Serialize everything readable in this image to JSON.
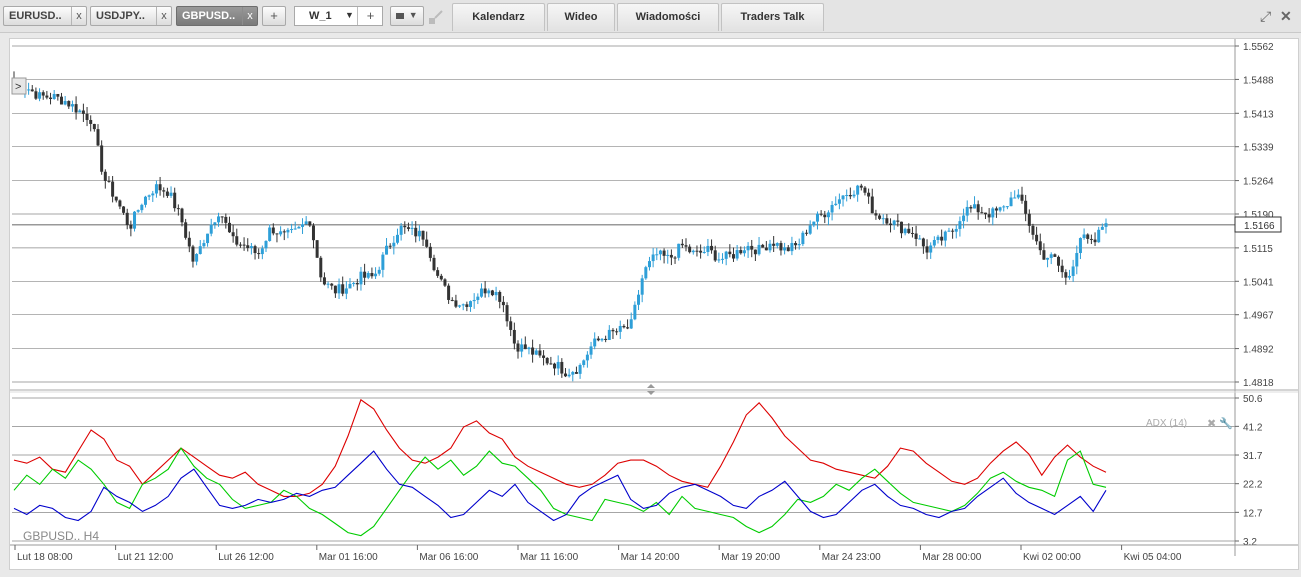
{
  "symbol_tabs": [
    {
      "label": "EURUSD..",
      "close": "x"
    },
    {
      "label": "USDJPY..",
      "close": "x"
    },
    {
      "label": "GBPUSD..",
      "close": "x"
    }
  ],
  "add_tab": "+",
  "timeframe": {
    "value": "W_1",
    "arrow": "▼",
    "plus": "+"
  },
  "chart_type_arrow": "▼",
  "nav_tabs": [
    "Kalendarz",
    "Wideo",
    "Wiadomości",
    "Traders Talk"
  ],
  "window_icons": [
    "expand-icon",
    "close-icon"
  ],
  "collapse_marker": ">",
  "chart_label": "GBPUSD.. H4",
  "indicator_label": "ADX (14)",
  "current_price": "1.5166",
  "colors": {
    "bull": "#2e9fd8",
    "bear": "#333333",
    "adx": "#dd0000",
    "plus_di": "#00cc00",
    "minus_di": "#0000cc"
  },
  "chart_data": {
    "type": "candlestick",
    "y_ticks": [
      "1.5562",
      "1.5488",
      "1.5413",
      "1.5339",
      "1.5264",
      "1.5190",
      "1.5115",
      "1.5041",
      "1.4967",
      "1.4892",
      "1.4818"
    ],
    "ylim": [
      1.4818,
      1.5562
    ],
    "x_ticks": [
      "Lut 18 08:00",
      "Lut 21 12:00",
      "Lut 26 12:00",
      "Mar 01 16:00",
      "Mar 06 16:00",
      "Mar 11 16:00",
      "Mar 14 20:00",
      "Mar 19 20:00",
      "Mar 24 23:00",
      "Mar 28 00:00",
      "Kwi 02 00:00",
      "Kwi 05 04:00"
    ],
    "close_anchors": [
      1.548,
      1.547,
      1.545,
      1.545,
      1.544,
      1.542,
      1.54,
      1.527,
      1.522,
      1.516,
      1.522,
      1.525,
      1.524,
      1.518,
      1.508,
      1.515,
      1.52,
      1.513,
      1.512,
      1.51,
      1.516,
      1.514,
      1.515,
      1.518,
      1.504,
      1.502,
      1.503,
      1.505,
      1.505,
      1.511,
      1.516,
      1.515,
      1.514,
      1.505,
      1.5,
      1.499,
      1.501,
      1.503,
      1.5,
      1.49,
      1.489,
      1.487,
      1.486,
      1.484,
      1.485,
      1.49,
      1.492,
      1.493,
      1.494,
      1.506,
      1.51,
      1.509,
      1.512,
      1.51,
      1.511,
      1.509,
      1.51,
      1.512,
      1.511,
      1.513,
      1.511,
      1.512,
      1.517,
      1.519,
      1.522,
      1.524,
      1.525,
      1.519,
      1.518,
      1.516,
      1.515,
      1.511,
      1.513,
      1.515,
      1.52,
      1.52,
      1.519,
      1.52,
      1.524,
      1.517,
      1.51,
      1.509,
      1.504,
      1.514,
      1.512,
      1.518
    ],
    "indicator": {
      "name": "ADX (14)",
      "y_ticks": [
        "50.6",
        "41.2",
        "31.7",
        "22.2",
        "12.7",
        "3.2"
      ],
      "ylim": [
        3.2,
        50.6
      ],
      "series": [
        {
          "key": "adx",
          "values": [
            30,
            29,
            31,
            27,
            26,
            33,
            40,
            37,
            30,
            28,
            22,
            26,
            30,
            34,
            31,
            28,
            25,
            24,
            26,
            22,
            20,
            18,
            18,
            19,
            22,
            28,
            38,
            50,
            47,
            40,
            34,
            30,
            29,
            31,
            34,
            41,
            43,
            39,
            37,
            31,
            28,
            26,
            24,
            22,
            21,
            22,
            25,
            29,
            30,
            30,
            28,
            25,
            23,
            22,
            21,
            28,
            36,
            45,
            49,
            44,
            38,
            34,
            30,
            29,
            27,
            26,
            25,
            24,
            28,
            34,
            33,
            29,
            26,
            23,
            22,
            24,
            29,
            33,
            36,
            32,
            25,
            31,
            35,
            31,
            28,
            26
          ]
        },
        {
          "key": "plus_di",
          "values": [
            20,
            25,
            22,
            27,
            24,
            30,
            27,
            22,
            16,
            14,
            22,
            24,
            27,
            34,
            28,
            24,
            22,
            17,
            14,
            15,
            16,
            20,
            18,
            14,
            12,
            9,
            6,
            5,
            8,
            14,
            20,
            26,
            31,
            27,
            30,
            25,
            28,
            33,
            29,
            28,
            24,
            20,
            14,
            12,
            11,
            10,
            17,
            16,
            15,
            13,
            16,
            12,
            18,
            14,
            13,
            12,
            11,
            8,
            6,
            8,
            12,
            17,
            16,
            18,
            22,
            20,
            24,
            27,
            23,
            19,
            16,
            15,
            14,
            13,
            15,
            19,
            24,
            26,
            23,
            21,
            20,
            18,
            30,
            33,
            22,
            21
          ]
        },
        {
          "key": "minus_di",
          "values": [
            14,
            12,
            15,
            14,
            11,
            10,
            13,
            21,
            18,
            16,
            13,
            15,
            18,
            24,
            27,
            21,
            15,
            14,
            15,
            17,
            16,
            17,
            19,
            18,
            20,
            21,
            25,
            29,
            33,
            27,
            22,
            21,
            18,
            15,
            11,
            12,
            16,
            20,
            18,
            22,
            16,
            13,
            10,
            12,
            18,
            21,
            23,
            25,
            17,
            14,
            15,
            19,
            21,
            22,
            20,
            18,
            15,
            14,
            18,
            20,
            23,
            18,
            13,
            11,
            12,
            16,
            20,
            22,
            18,
            15,
            14,
            12,
            11,
            13,
            14,
            18,
            21,
            24,
            19,
            16,
            14,
            12,
            15,
            18,
            13,
            20
          ]
        }
      ]
    }
  }
}
